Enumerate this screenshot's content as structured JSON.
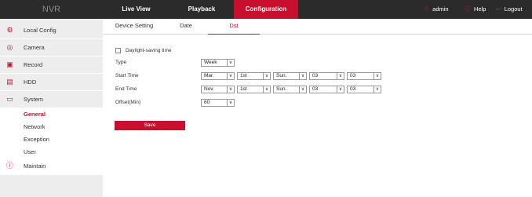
{
  "app": {
    "title": "NVR"
  },
  "nav": {
    "tabs": [
      {
        "label": "Live View"
      },
      {
        "label": "Playback"
      },
      {
        "label": "Configuration"
      }
    ],
    "user": "admin",
    "help": "Help",
    "logout": "Logout"
  },
  "sidebar": {
    "items": [
      {
        "label": "Local Config",
        "icon": "gear-icon"
      },
      {
        "label": "Camera",
        "icon": "camera-icon"
      },
      {
        "label": "Record",
        "icon": "record-icon"
      },
      {
        "label": "HDD",
        "icon": "hdd-icon"
      },
      {
        "label": "System",
        "icon": "monitor-icon"
      },
      {
        "label": "Maintain",
        "icon": "info-icon"
      }
    ],
    "system_sub": [
      "General",
      "Network",
      "Exception",
      "User"
    ]
  },
  "tabs": [
    {
      "label": "Device Setting"
    },
    {
      "label": "Date"
    },
    {
      "label": "Dst"
    }
  ],
  "dst": {
    "checkbox_label": "Daylight-saving time",
    "type_label": "Type",
    "type_value": "Week",
    "start_label": "Start Time",
    "start": [
      "Mar.",
      "1st",
      "Sun.",
      "03",
      "03"
    ],
    "end_label": "End Time",
    "end": [
      "Nov.",
      "1st",
      "Sun.",
      "03",
      "03"
    ],
    "offset_label": "Offset(Min)",
    "offset_value": "60",
    "save_label": "Save"
  },
  "colors": {
    "accent": "#c8102e",
    "topbar": "#2b2b2b",
    "sidebar": "#ededed"
  }
}
